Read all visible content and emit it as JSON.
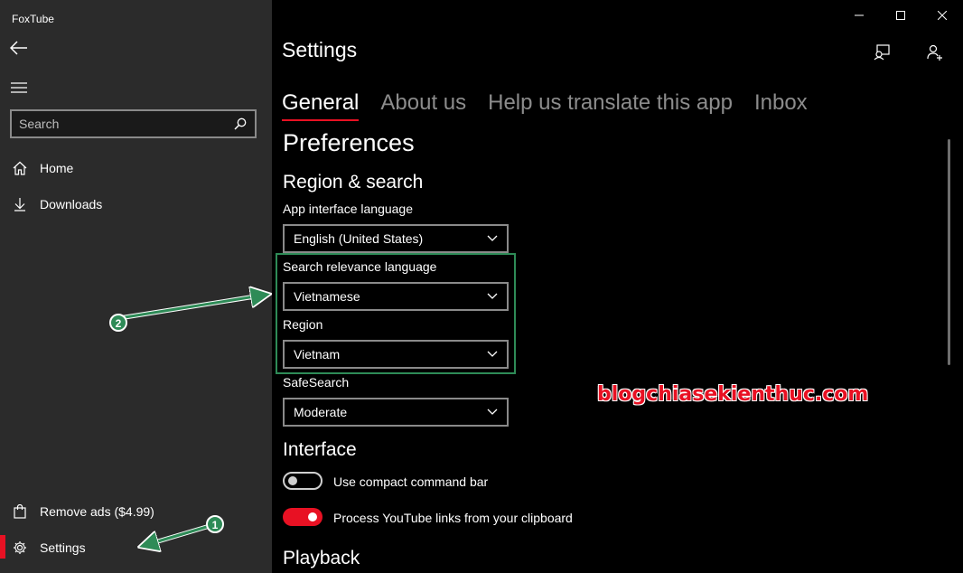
{
  "app": {
    "title": "FoxTube"
  },
  "sidebar": {
    "search_placeholder": "Search",
    "items": [
      {
        "label": "Home",
        "icon": "home-icon"
      },
      {
        "label": "Downloads",
        "icon": "download-icon"
      }
    ],
    "bottom_items": [
      {
        "label": "Remove ads ($4.99)",
        "icon": "shopping-bag-icon"
      },
      {
        "label": "Settings",
        "icon": "gear-icon",
        "selected": true
      }
    ]
  },
  "main": {
    "title": "Settings",
    "tabs": [
      {
        "label": "General",
        "active": true
      },
      {
        "label": "About us",
        "active": false
      },
      {
        "label": "Help us translate this app",
        "active": false
      },
      {
        "label": "Inbox",
        "active": false
      }
    ],
    "preferences_heading": "Preferences",
    "region_heading": "Region & search",
    "app_language_label": "App interface language",
    "app_language_value": "English (United States)",
    "search_language_label": "Search relevance language",
    "search_language_value": "Vietnamese",
    "region_label": "Region",
    "region_value": "Vietnam",
    "safesearch_label": "SafeSearch",
    "safesearch_value": "Moderate",
    "interface_heading": "Interface",
    "compact_bar_label": "Use compact command bar",
    "compact_bar_on": false,
    "clipboard_label": "Process YouTube links from your clipboard",
    "clipboard_on": true,
    "playback_heading": "Playback"
  },
  "annotations": {
    "marker_1": "1",
    "marker_2": "2",
    "watermark": "blogchiasekienthuc.com"
  },
  "colors": {
    "accent": "#e81123",
    "sidebar_bg": "#2b2b2b",
    "main_bg": "#000000",
    "annotation_green": "#2e8b57"
  }
}
